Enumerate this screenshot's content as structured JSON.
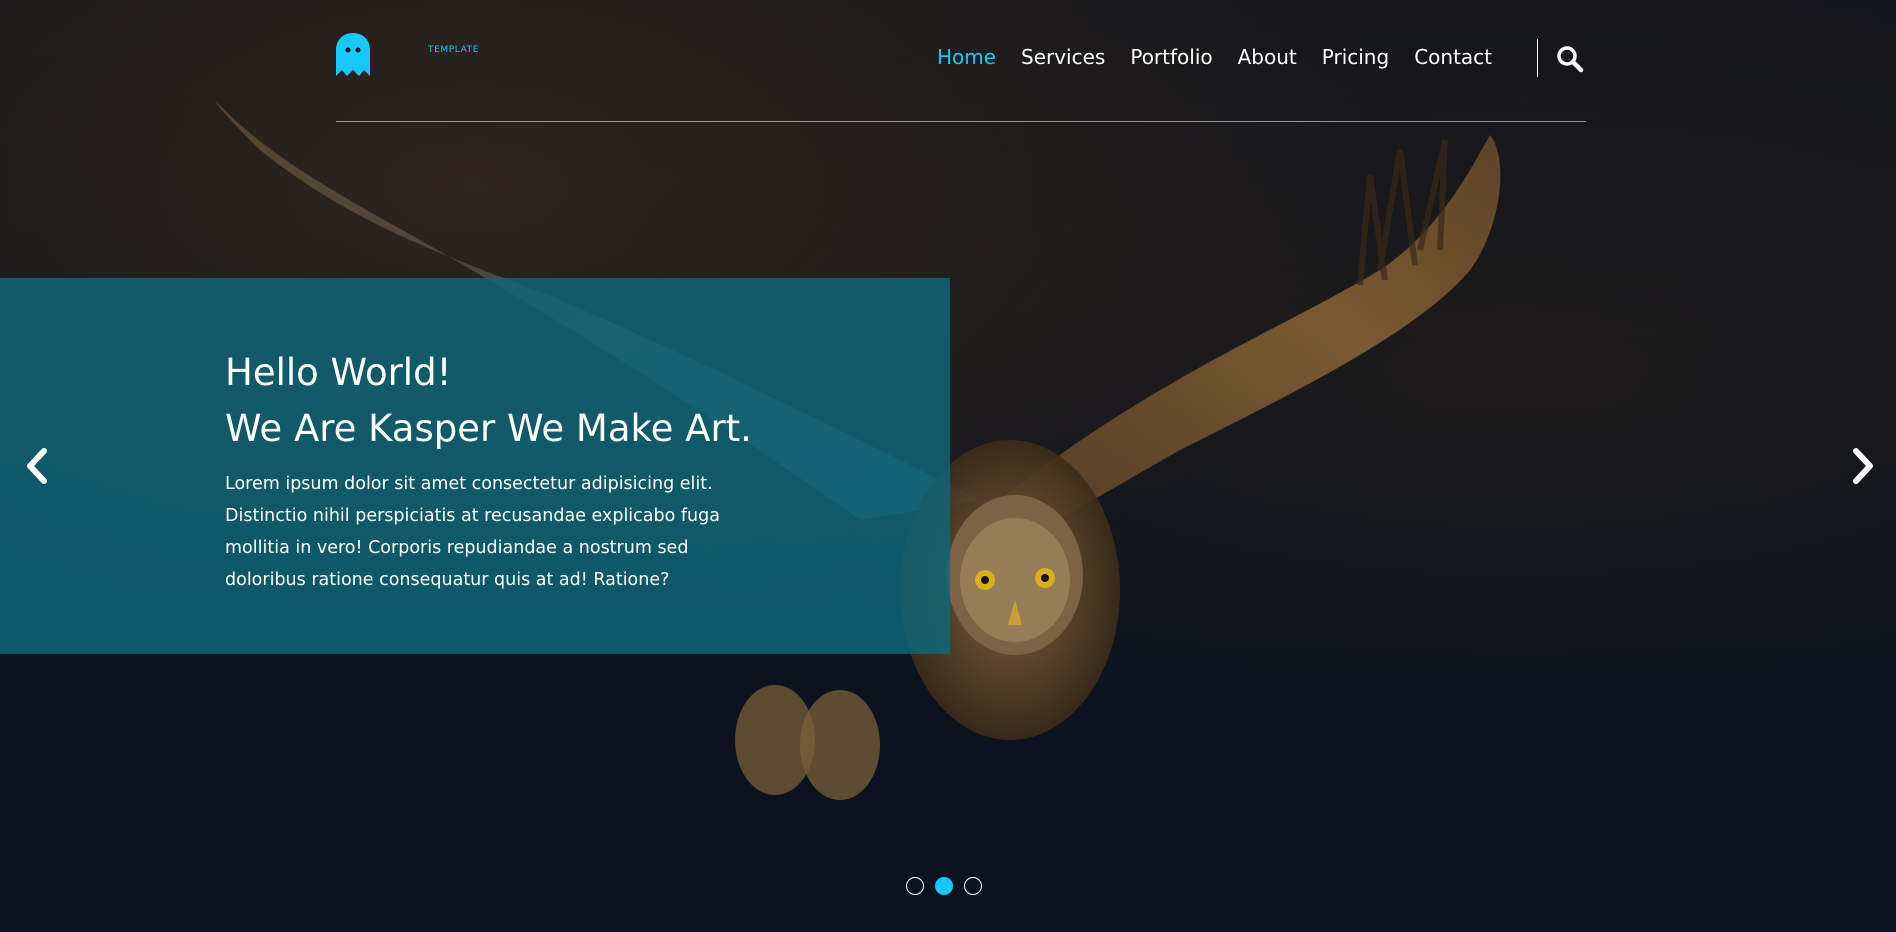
{
  "brand": {
    "logo_icon": "ghost-icon",
    "tagline": "TEMPLATE",
    "accent_color": "#19c8fa"
  },
  "nav": {
    "items": [
      {
        "label": "Home",
        "active": true
      },
      {
        "label": "Services",
        "active": false
      },
      {
        "label": "Portfolio",
        "active": false
      },
      {
        "label": "About",
        "active": false
      },
      {
        "label": "Pricing",
        "active": false
      },
      {
        "label": "Contact",
        "active": false
      }
    ],
    "search_icon": "search-icon"
  },
  "hero": {
    "heading_line1": "Hello World!",
    "heading_line2": "We Are Kasper We Make Art.",
    "paragraph_lines": [
      "Lorem ipsum dolor sit amet consectetur adipisicing elit.",
      "Distinctio nihil perspiciatis at recusandae explicabo fuga",
      "mollitia in vero! Corporis repudiandae a nostrum sed",
      "doloribus ratione consequatur quis at ad! Ratione?"
    ],
    "prev_icon": "chevron-left-icon",
    "next_icon": "chevron-right-icon",
    "box_color": "#0e687a"
  },
  "slider": {
    "bullets": [
      {
        "active": false
      },
      {
        "active": true
      },
      {
        "active": false
      }
    ]
  }
}
